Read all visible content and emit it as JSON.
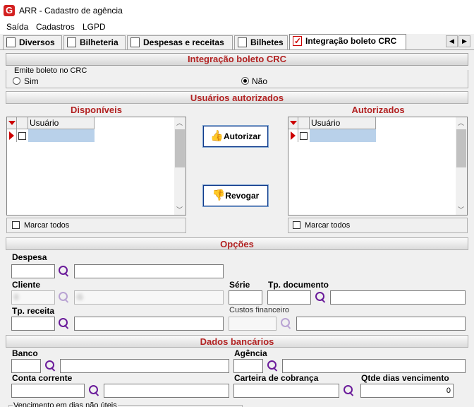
{
  "window": {
    "title": "ARR - Cadastro de agência"
  },
  "menu": [
    "Saída",
    "Cadastros",
    "LGPD"
  ],
  "tabs": [
    "Diversos",
    "Bilheteria",
    "Despesas e receitas",
    "Bilhetes",
    "Integração boleto CRC"
  ],
  "main": {
    "panel_title": "Integração boleto CRC",
    "emite": {
      "legend": "Emite boleto no CRC",
      "sim": "Sim",
      "nao": "Não",
      "selected": "Não"
    },
    "usuarios": {
      "title": "Usuários autorizados",
      "disponiveis": {
        "title": "Disponíveis",
        "column": "Usuário",
        "marcar": "Marcar todos"
      },
      "autorizados": {
        "title": "Autorizados",
        "column": "Usuário",
        "marcar": "Marcar todos"
      },
      "autorizar_button": "Autorizar",
      "revogar_button": "Revogar"
    },
    "opcoes": {
      "title": "Opções",
      "despesa": "Despesa",
      "cliente": "Cliente",
      "cliente_code": "0",
      "cliente_name": "G",
      "serie": "Série",
      "tp_documento": "Tp. documento",
      "tp_receita": "Tp. receita",
      "custos_financeiro": "Custos financeiro"
    },
    "dados": {
      "title": "Dados bancários",
      "banco": "Banco",
      "agencia": "Agência",
      "conta_corrente": "Conta corrente",
      "carteira": "Carteira de cobrança",
      "qtde": "Qtde dias vencimento",
      "qtde_value": "0",
      "vencimento": "Vencimento em dias não úteis"
    }
  },
  "colors": {
    "accent": "#b22222",
    "selection": "#b9d1ea",
    "button_border": "#0f3a8c"
  }
}
